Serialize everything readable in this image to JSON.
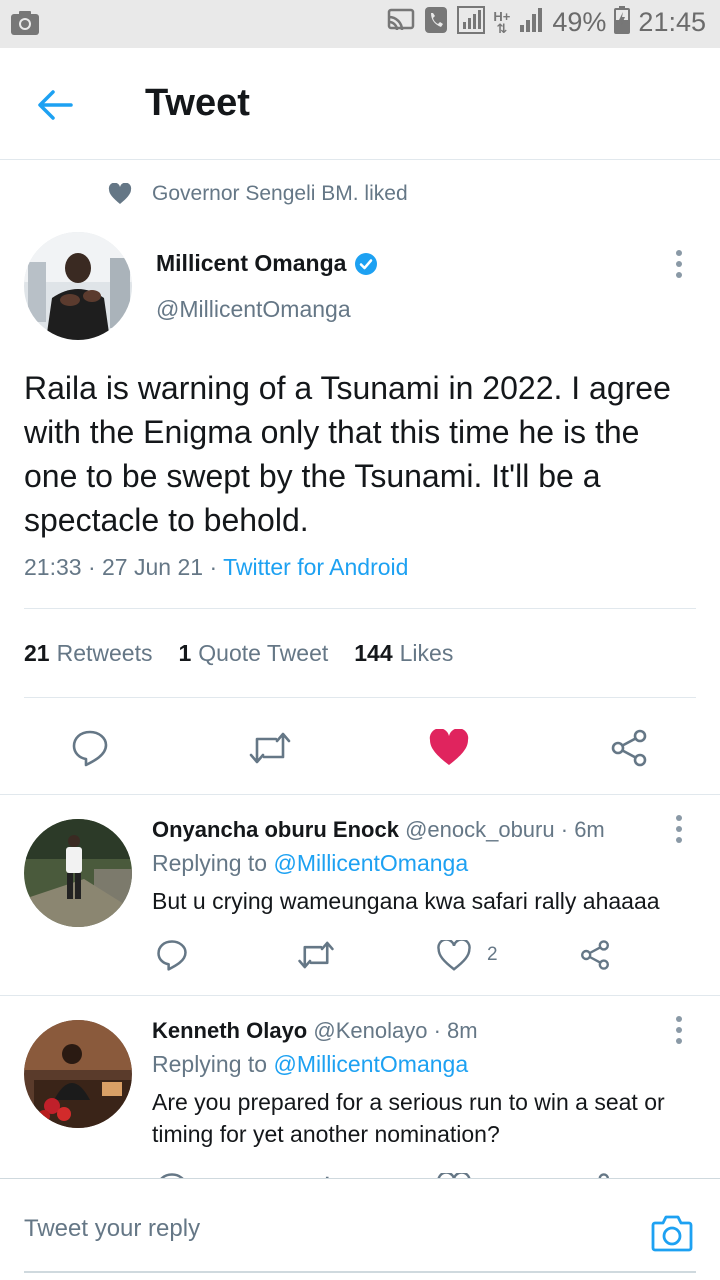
{
  "status_bar": {
    "battery": "49%",
    "time": "21:45",
    "network": "H+"
  },
  "header": {
    "title": "Tweet"
  },
  "social_context": {
    "text": "Governor Sengeli BM. liked"
  },
  "tweet": {
    "author_name": "Millicent Omanga",
    "author_handle": "@MillicentOmanga",
    "verified": true,
    "text": "Raila is warning of a Tsunami in 2022. I agree with the Enigma only that this time he is the one to be swept by the Tsunami. It'll be a spectacle to behold.",
    "time": "21:33",
    "date": "27 Jun 21",
    "source": "Twitter for Android",
    "liked": true
  },
  "stats": {
    "retweets_count": "21",
    "retweets_label": "Retweets",
    "quotes_count": "1",
    "quotes_label": "Quote Tweet",
    "likes_count": "144",
    "likes_label": "Likes"
  },
  "replies": [
    {
      "name": "Onyancha oburu Enock",
      "handle": "@enock_oburu",
      "age": "6m",
      "replying_label": "Replying to",
      "replying_to": "@MillicentOmanga",
      "text": "But u crying wameungana kwa safari rally ahaaaa",
      "like_count": "2"
    },
    {
      "name": "Kenneth Olayo",
      "handle": "@Kenolayo",
      "age": "8m",
      "replying_label": "Replying to",
      "replying_to": "@MillicentOmanga",
      "text": "Are you prepared for a serious run to win a seat or timing for yet another nomination?",
      "like_count": ""
    }
  ],
  "composer": {
    "placeholder": "Tweet your reply"
  },
  "colors": {
    "accent": "#1da1f2",
    "like": "#e0245e",
    "secondary_text": "#657786",
    "divider": "#e1e8ed"
  },
  "icons": {
    "back": "arrow-left-icon",
    "verified": "verified-badge-icon",
    "reply": "reply-icon",
    "retweet": "retweet-icon",
    "like": "heart-icon",
    "share": "share-icon",
    "camera": "camera-icon"
  }
}
